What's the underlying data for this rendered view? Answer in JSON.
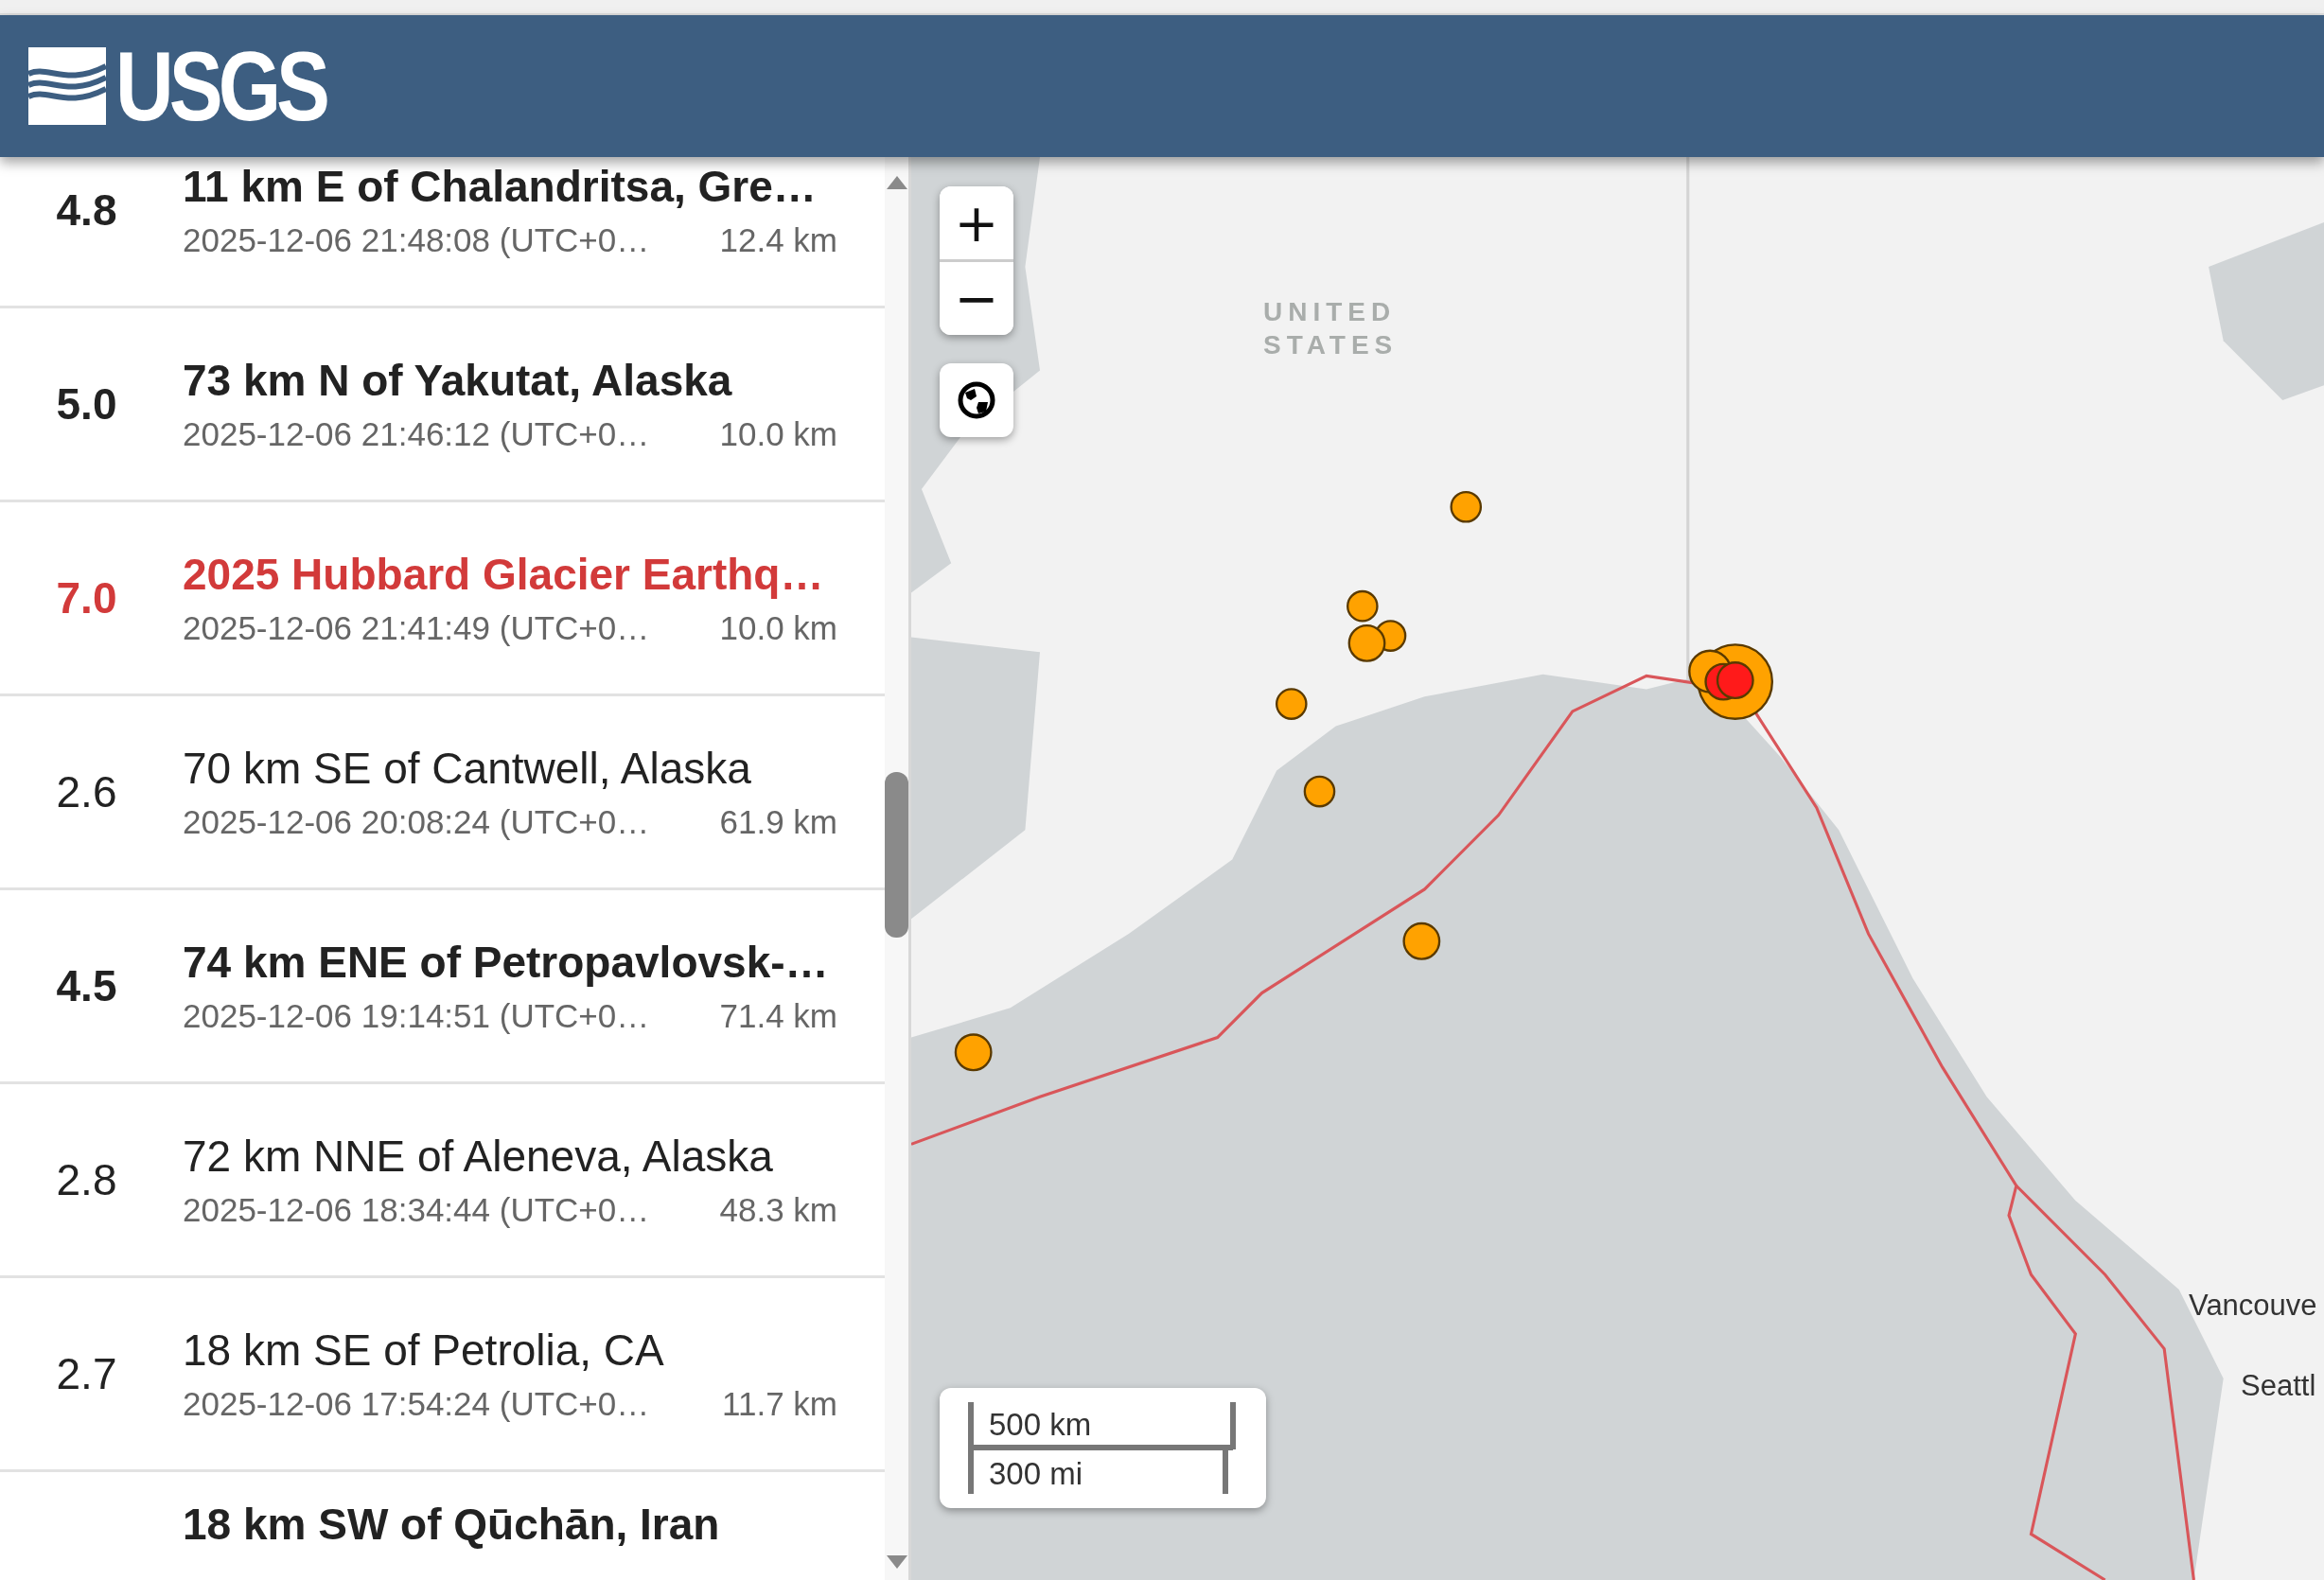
{
  "header": {
    "logo": "USGS"
  },
  "events": [
    {
      "kind": "major",
      "magnitude": "4.8",
      "title": "11 km E of Chalandritsa, Gre…",
      "time": "2025-12-06 21:48:08 (UTC+0…",
      "depth": "12.4 km"
    },
    {
      "kind": "major",
      "magnitude": "5.0",
      "title": "73 km N of Yakutat, Alaska",
      "time": "2025-12-06 21:46:12 (UTC+0…",
      "depth": "10.0 km"
    },
    {
      "kind": "significant",
      "magnitude": "7.0",
      "title": "2025 Hubbard Glacier Earthq…",
      "time": "2025-12-06 21:41:49 (UTC+0…",
      "depth": "10.0 km"
    },
    {
      "kind": "minor",
      "magnitude": "2.6",
      "title": "70 km SE of Cantwell, Alaska",
      "time": "2025-12-06 20:08:24 (UTC+0…",
      "depth": "61.9 km"
    },
    {
      "kind": "major",
      "magnitude": "4.5",
      "title": "74 km ENE of Petropavlovsk-…",
      "time": "2025-12-06 19:14:51 (UTC+0…",
      "depth": "71.4 km"
    },
    {
      "kind": "minor",
      "magnitude": "2.8",
      "title": "72 km NNE of Aleneva, Alaska",
      "time": "2025-12-06 18:34:44 (UTC+0…",
      "depth": "48.3 km"
    },
    {
      "kind": "minor",
      "magnitude": "2.7",
      "title": "18 km SE of Petrolia, CA",
      "time": "2025-12-06 17:54:24 (UTC+0…",
      "depth": "11.7 km"
    },
    {
      "kind": "major",
      "title": "18 km SW of Qūchān, Iran"
    }
  ],
  "map": {
    "zoom_in": "+",
    "zoom_out": "−",
    "country_label": "UNITED STATES",
    "city_labels": [
      "Vancouve",
      "Seattl"
    ],
    "scale": {
      "metric": "500 km",
      "imperial": "300 mi"
    }
  }
}
